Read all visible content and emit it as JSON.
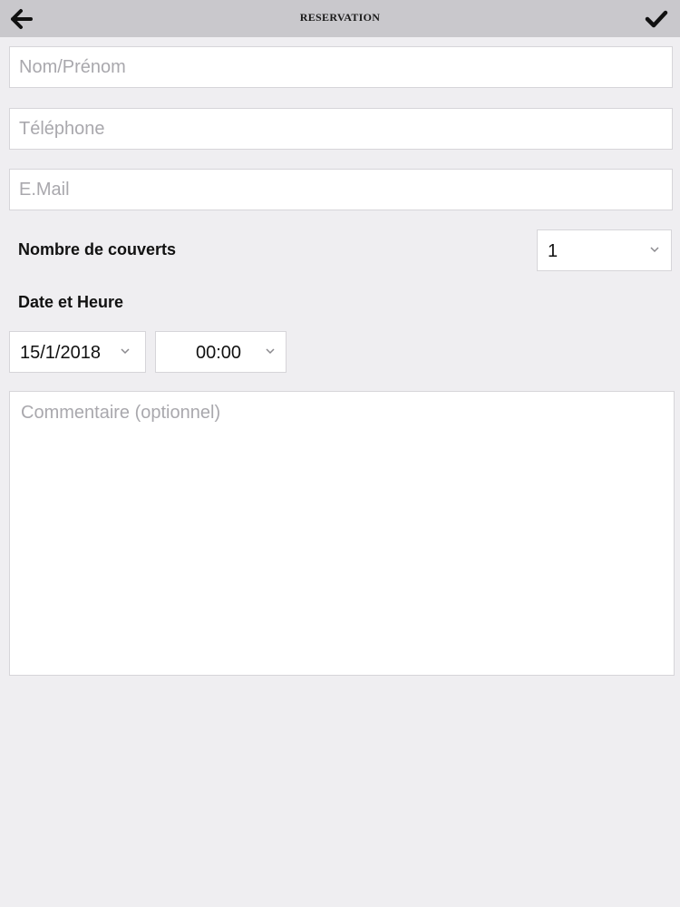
{
  "header": {
    "title": "RESERVATION",
    "back_icon": "arrow-left-icon",
    "confirm_icon": "checkmark-icon"
  },
  "form": {
    "name_placeholder": "Nom/Prénom",
    "phone_placeholder": "Téléphone",
    "email_placeholder": "E.Mail",
    "covers_label": "Nombre de couverts",
    "covers_value": "1",
    "datetime_label": "Date et Heure",
    "date_value": "15/1/2018",
    "time_value": "00:00",
    "comment_placeholder": "Commentaire (optionnel)"
  },
  "colors": {
    "header_bg": "#c9c8cc",
    "page_bg": "#efeef1",
    "field_bg": "#ffffff",
    "placeholder": "#a9a8ad"
  }
}
